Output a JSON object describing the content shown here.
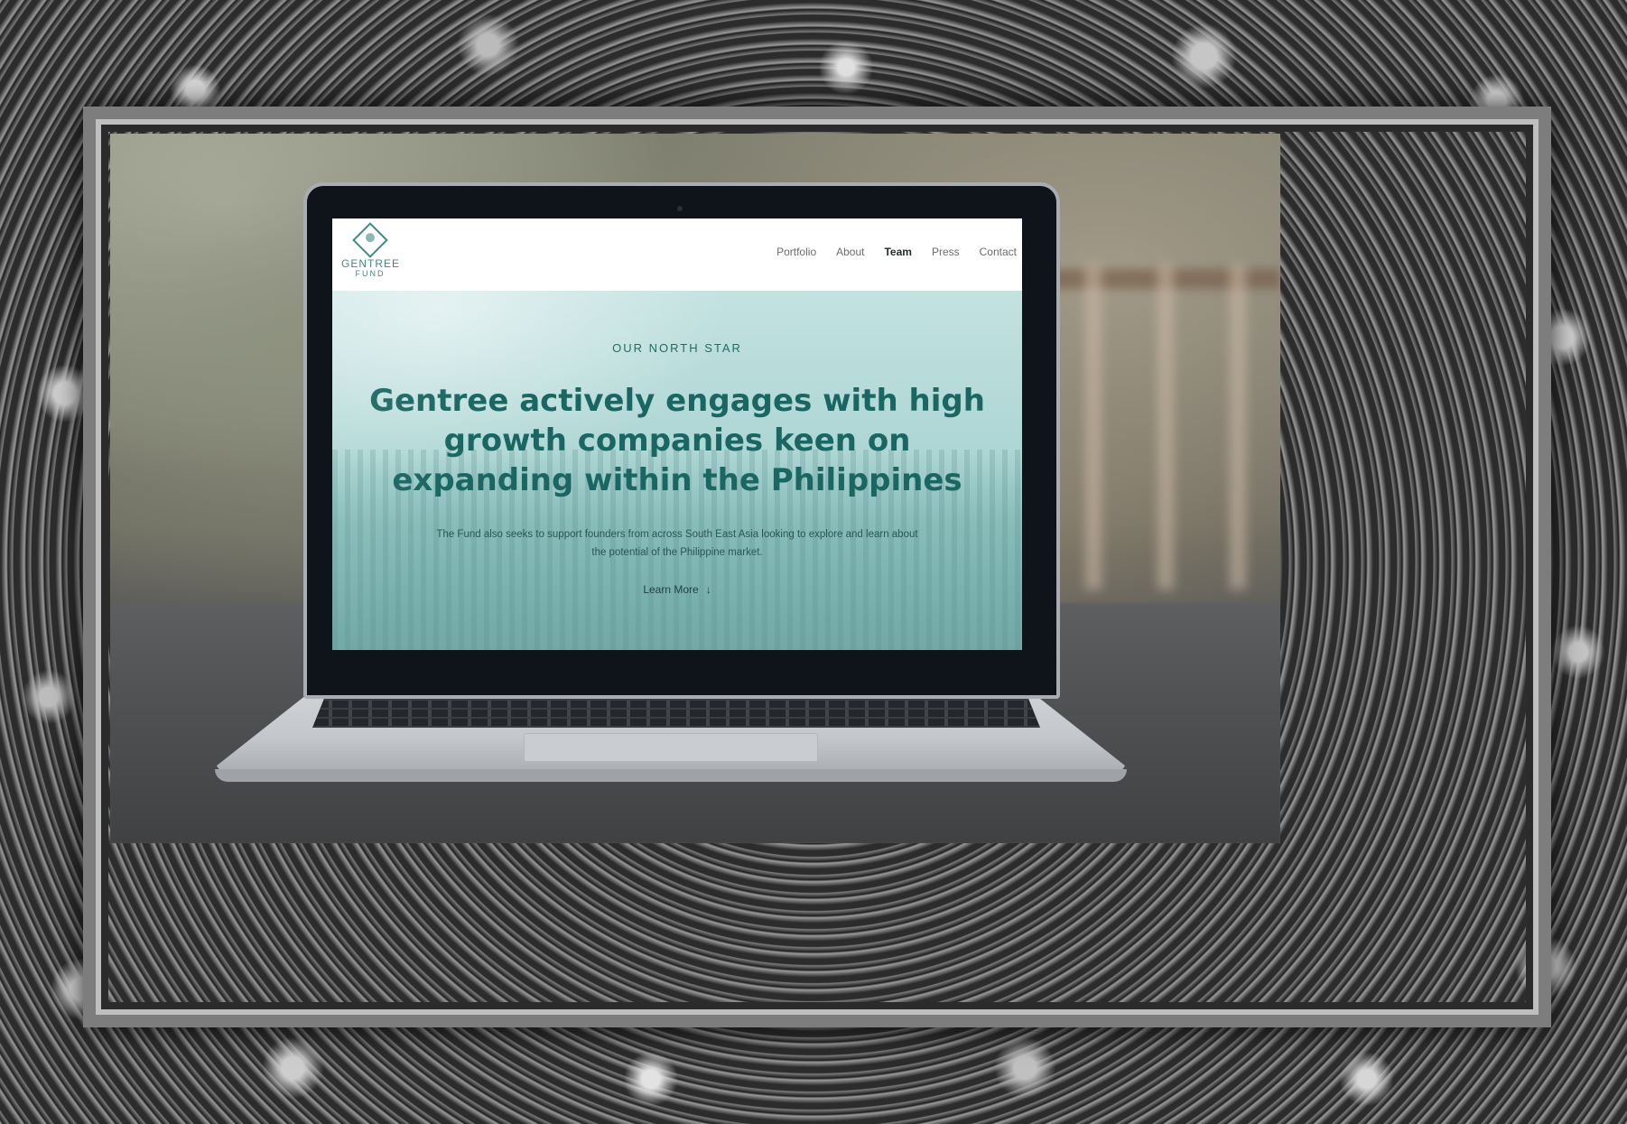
{
  "site": {
    "logo": {
      "name": "GENTREE",
      "sub": "FUND",
      "icon": "tree-diamond-icon"
    },
    "nav": [
      {
        "label": "Portfolio",
        "active": false
      },
      {
        "label": "About",
        "active": false
      },
      {
        "label": "Team",
        "active": true
      },
      {
        "label": "Press",
        "active": false
      },
      {
        "label": "Contact",
        "active": false
      }
    ],
    "hero": {
      "eyebrow": "OUR NORTH STAR",
      "headline": "Gentree actively engages with high growth companies keen on expanding within the Philippines",
      "body": "The Fund also seeks to support founders from across South East Asia looking to explore and learn about the potential of the Philippine market.",
      "cta": "Learn More",
      "cta_icon": "arrow-down-icon"
    }
  },
  "colors": {
    "brand_teal": "#1a6662",
    "hero_bg": "#add6d4",
    "frame": "#7d7d7d"
  }
}
